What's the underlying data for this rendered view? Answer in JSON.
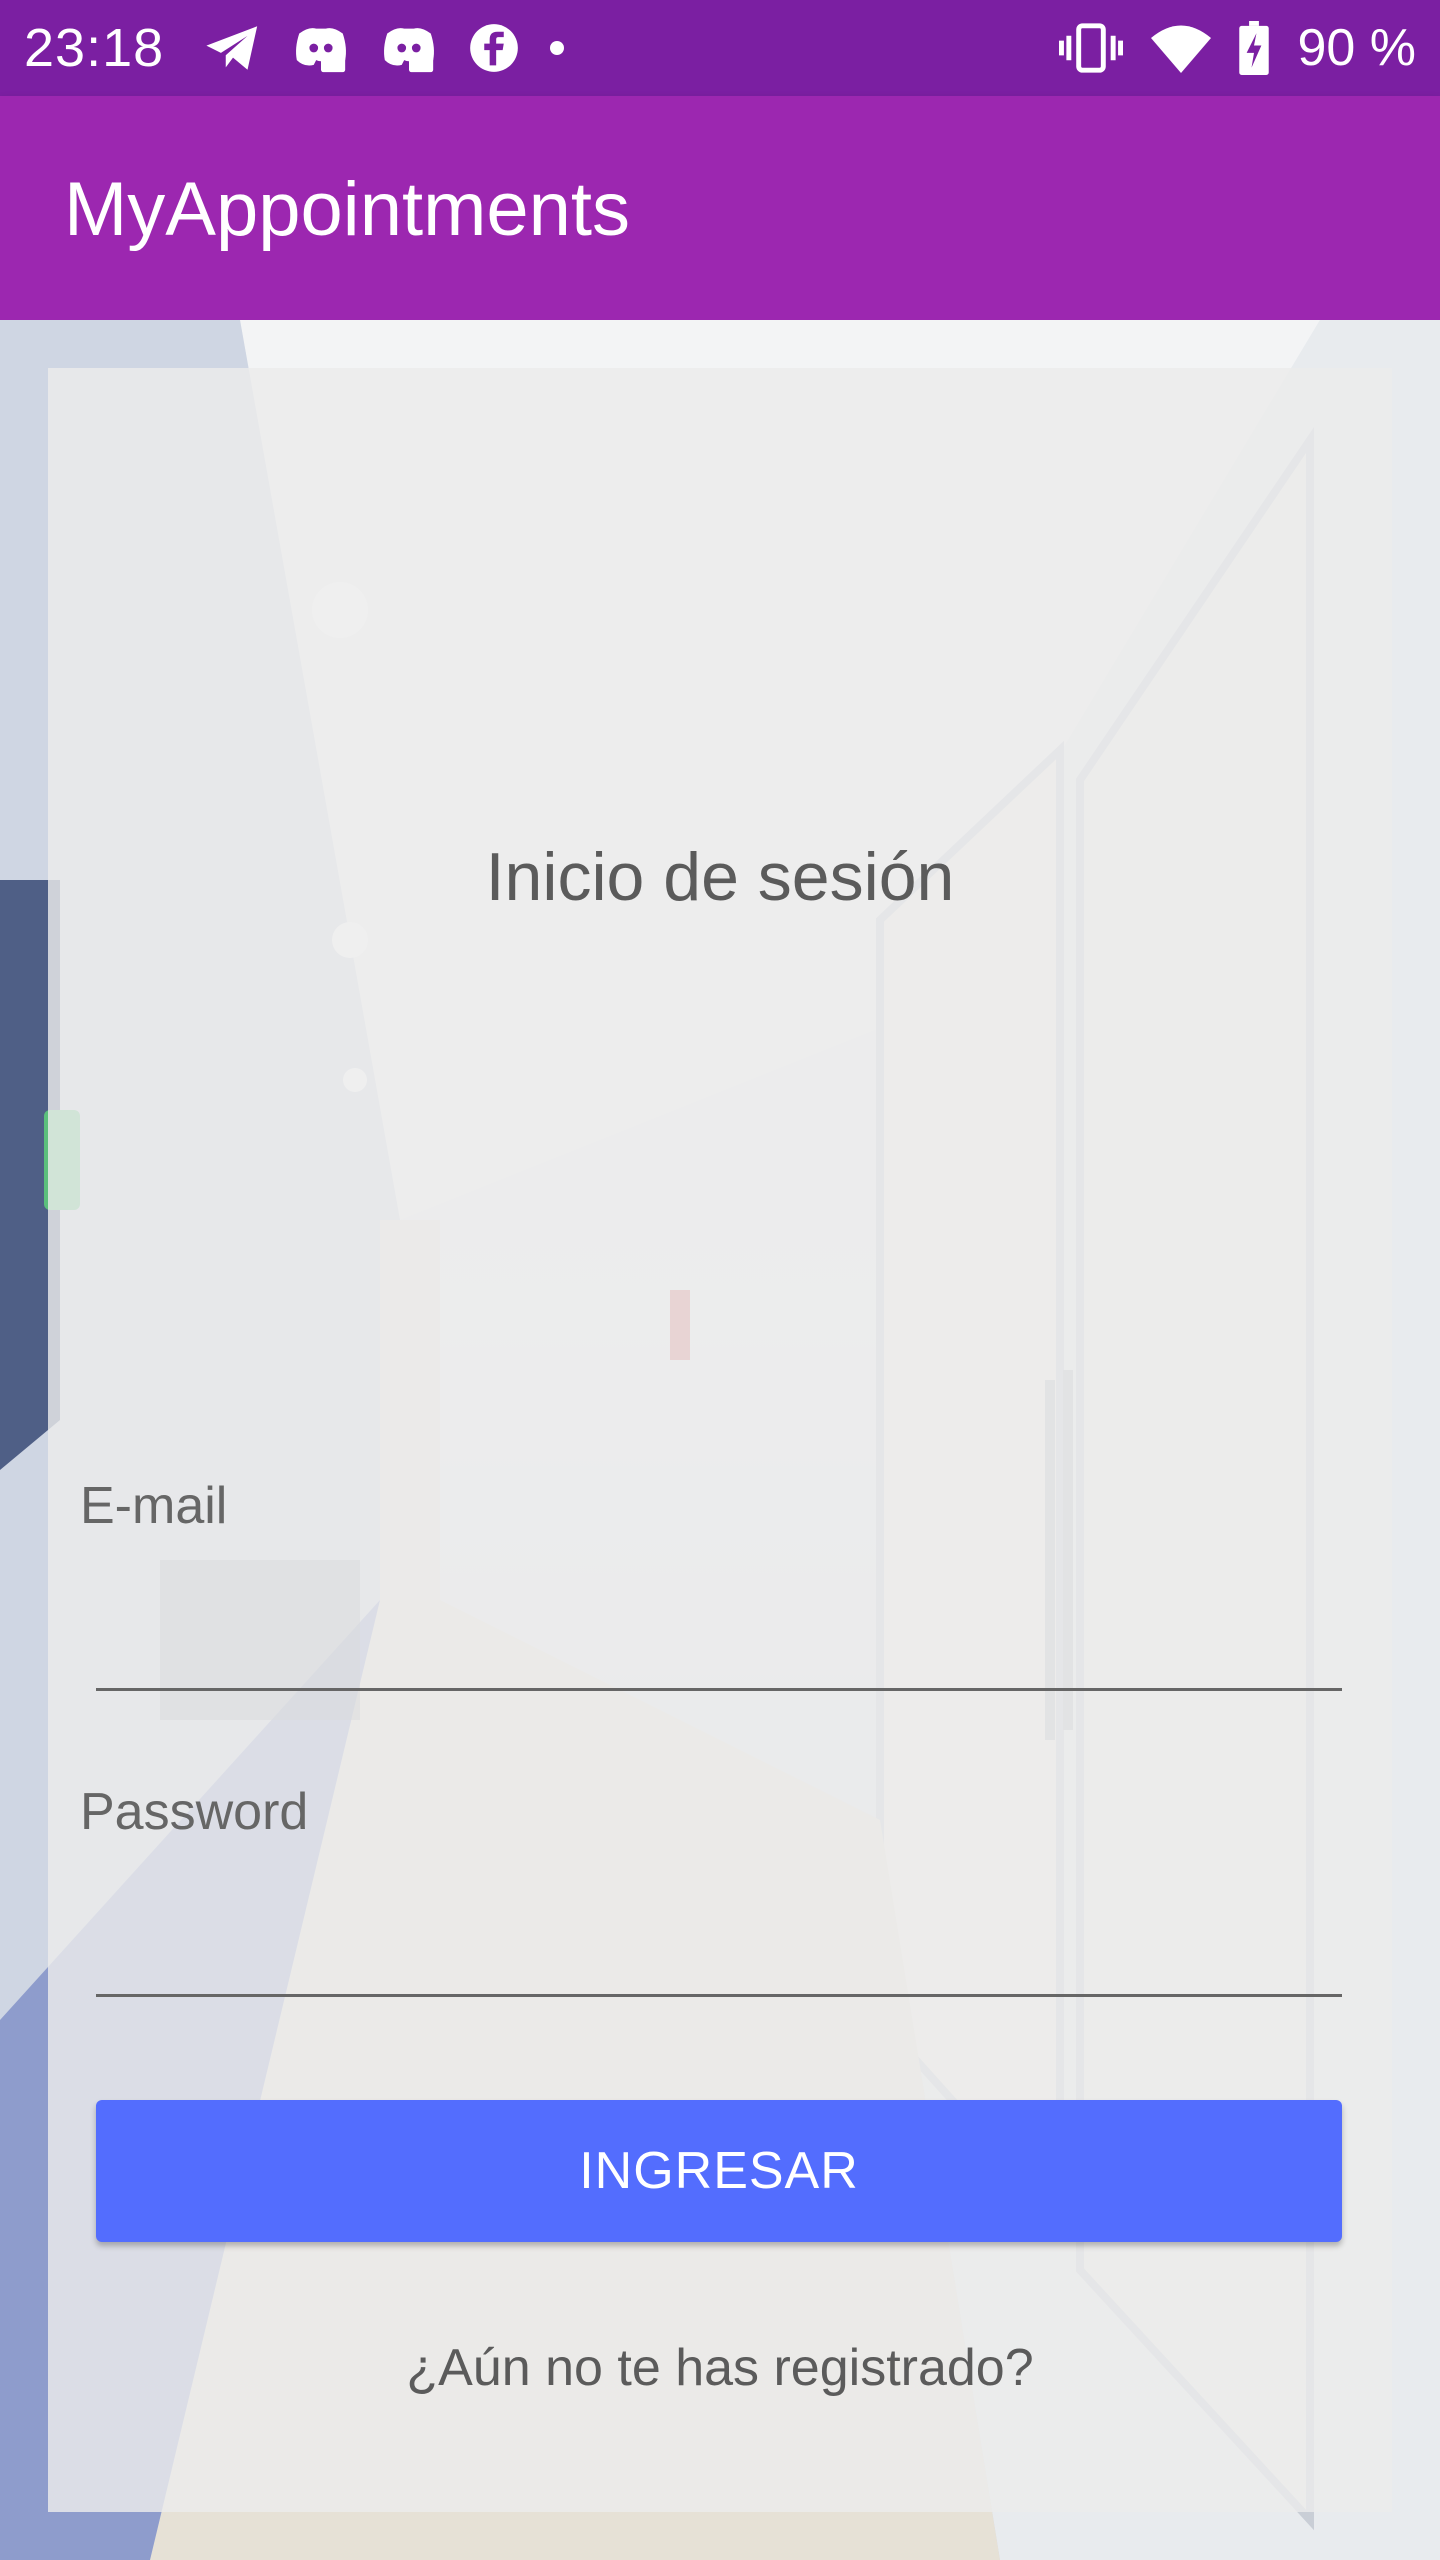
{
  "status_bar": {
    "time": "23:18",
    "left_icons": [
      "telegram-icon",
      "discord-icon",
      "discord-icon",
      "facebook-icon",
      "notification-dot-icon"
    ],
    "right_icons": [
      "vibrate-icon",
      "wifi-icon",
      "battery-charging-icon"
    ],
    "battery_text": "90 %",
    "background_color": "#7b1fa2"
  },
  "app_bar": {
    "title": "MyAppointments",
    "background_color": "#9c27b0"
  },
  "login": {
    "title": "Inicio de sesión",
    "email_label": "E-mail",
    "email_value": "",
    "password_label": "Password",
    "password_value": "",
    "submit_label": "INGRESAR",
    "submit_color": "#536dfe",
    "register_link": "¿Aún no te has registrado?"
  }
}
